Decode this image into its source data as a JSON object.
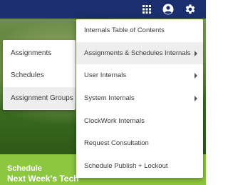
{
  "header": {
    "apps_icon": "grid-apps-icon",
    "account_icon": "account-circle-icon",
    "settings_icon": "gear-icon",
    "bar_color": "#1b2f6e"
  },
  "banner": {
    "title_line1": "Schedule",
    "title_line2": "Next Week's Tech",
    "band_color": "#8dc63f"
  },
  "submenu": {
    "items": [
      {
        "label": "Assignments"
      },
      {
        "label": "Schedules"
      },
      {
        "label": "Assignment Groups"
      }
    ],
    "active": "Assignment Groups"
  },
  "settings_menu": {
    "items": [
      {
        "label": "Internals Table of Contents",
        "has_submenu": false
      },
      {
        "label": "Assignments & Schedules Internals",
        "has_submenu": true
      },
      {
        "label": "User Internals",
        "has_submenu": true
      },
      {
        "label": "System Internals",
        "has_submenu": true
      },
      {
        "label": "ClockWork Internals",
        "has_submenu": false
      },
      {
        "label": "Request Consultation",
        "has_submenu": false
      },
      {
        "label": "Schedule Publish + Lockout",
        "has_submenu": false
      }
    ],
    "active": "Assignments & Schedules Internals"
  }
}
